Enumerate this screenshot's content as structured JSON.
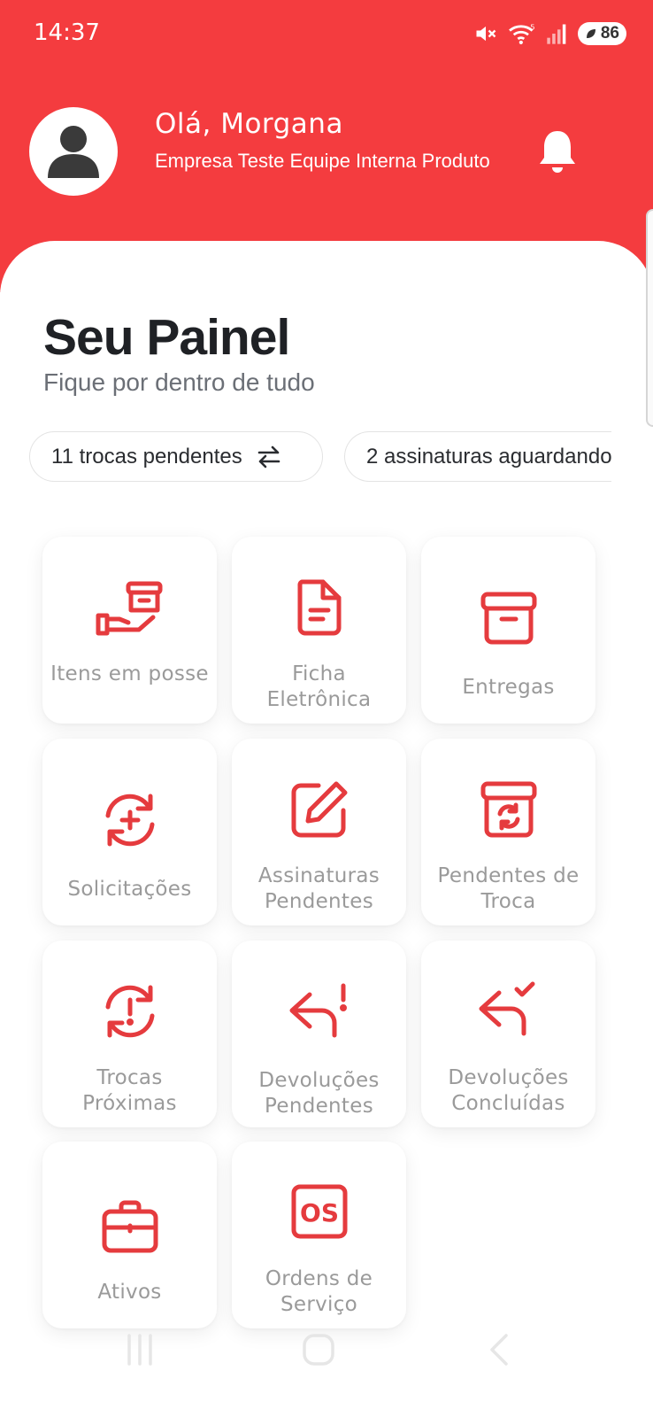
{
  "status_bar": {
    "time": "14:37",
    "battery": "86"
  },
  "header": {
    "greeting": "Olá, Morgana",
    "company": "Empresa Teste Equipe Interna Produto"
  },
  "panel": {
    "title": "Seu Painel",
    "subtitle": "Fique por dentro de tudo"
  },
  "chips": [
    {
      "label": "11 trocas pendentes"
    },
    {
      "label": "2 assinaturas aguardando"
    }
  ],
  "tiles": [
    {
      "label": "Itens em posse",
      "icon": "hand-box-icon"
    },
    {
      "label": "Ficha Eletrônica",
      "icon": "document-icon"
    },
    {
      "label": "Entregas",
      "icon": "archive-box-icon"
    },
    {
      "label": "Solicitações",
      "icon": "refresh-plus-icon"
    },
    {
      "label": "Assinaturas Pendentes",
      "icon": "edit-pen-icon"
    },
    {
      "label": "Pendentes de Troca",
      "icon": "archive-refresh-icon"
    },
    {
      "label": "Trocas Próximas",
      "icon": "refresh-alert-icon"
    },
    {
      "label": "Devoluções Pendentes",
      "icon": "return-alert-icon"
    },
    {
      "label": "Devoluções Concluídas",
      "icon": "return-check-icon"
    },
    {
      "label": "Ativos",
      "icon": "briefcase-icon"
    },
    {
      "label": "Ordens de Serviço",
      "icon": "os-icon"
    }
  ],
  "colors": {
    "brand": "#f43c3f",
    "icon_red": "#e53b3e",
    "label_gray": "#9a9a9a"
  }
}
